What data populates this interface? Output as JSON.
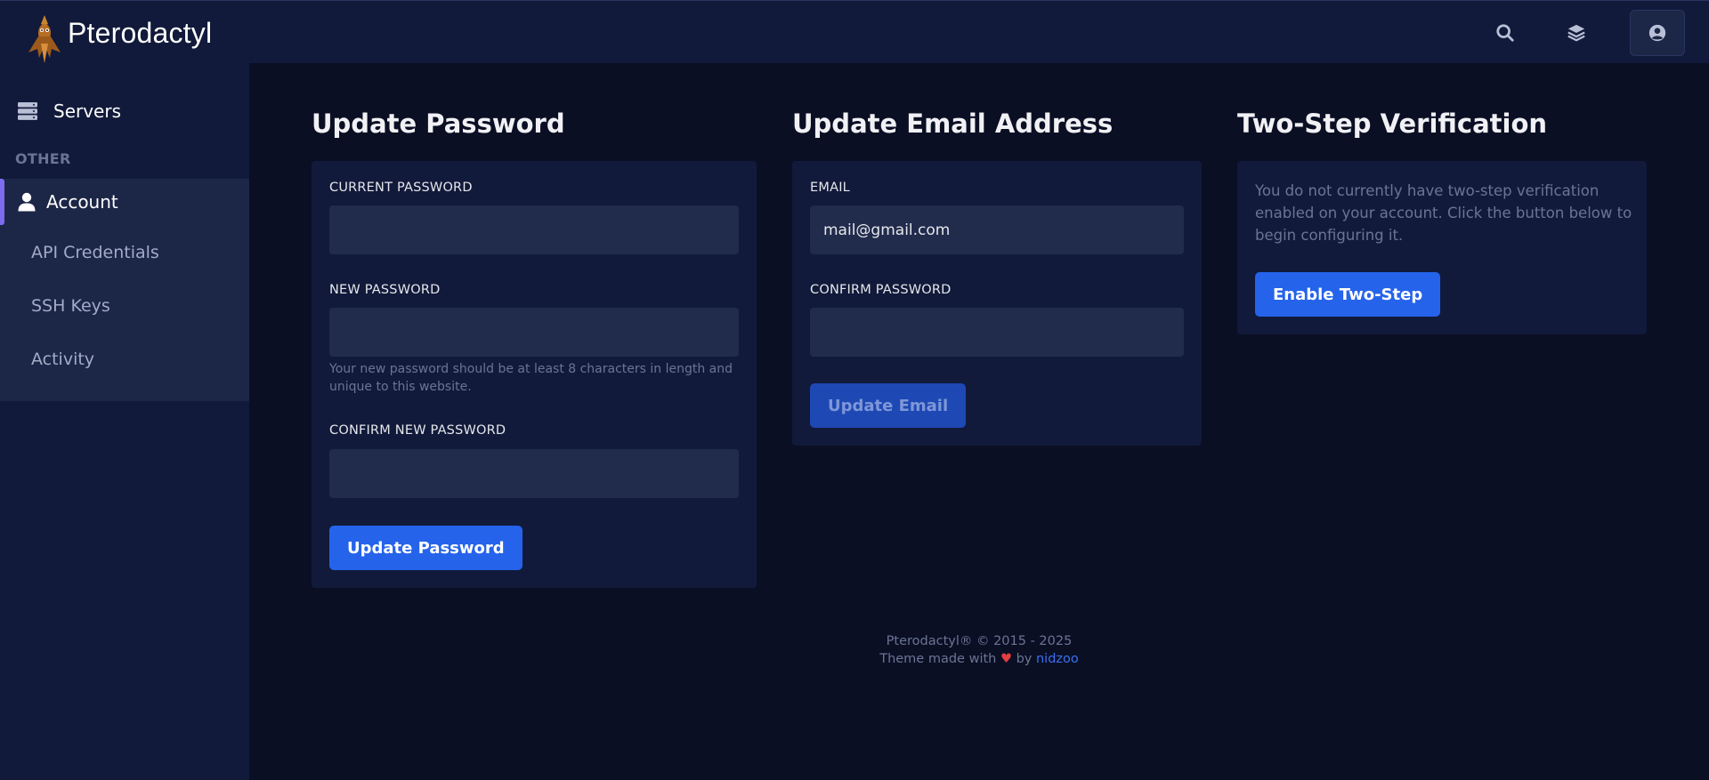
{
  "app": {
    "name": "Pterodactyl"
  },
  "topbar": {
    "search_icon": "search-icon",
    "layers_icon": "layers-icon",
    "account_icon": "user-circle-icon"
  },
  "sidebar": {
    "servers_label": "Servers",
    "other_heading": "OTHER",
    "account_label": "Account",
    "items": [
      {
        "label": "API Credentials"
      },
      {
        "label": "SSH Keys"
      },
      {
        "label": "Activity"
      }
    ]
  },
  "update_password": {
    "title": "Update Password",
    "current_label": "CURRENT PASSWORD",
    "current_value": "",
    "new_label": "NEW PASSWORD",
    "new_value": "",
    "new_hint": "Your new password should be at least 8 characters in length and unique to this website.",
    "confirm_label": "CONFIRM NEW PASSWORD",
    "confirm_value": "",
    "button": "Update Password"
  },
  "update_email": {
    "title": "Update Email Address",
    "email_label": "EMAIL",
    "email_value": "mail@gmail.com",
    "confirm_label": "CONFIRM PASSWORD",
    "confirm_value": "",
    "button": "Update Email"
  },
  "two_step": {
    "title": "Two-Step Verification",
    "description": "You do not currently have two-step verification enabled on your account. Click the button below to begin configuring it.",
    "button": "Enable Two-Step"
  },
  "footer": {
    "copyright": "Pterodactyl® © 2015 - 2025",
    "theme_prefix": "Theme made with",
    "heart": "♥",
    "theme_by": "by",
    "author": "nidzoo"
  },
  "colors": {
    "background": "#0a0f24",
    "panel": "#111a3a",
    "input": "#212b4c",
    "accent": "#2563eb",
    "active_indicator": "#7c6cf0"
  }
}
